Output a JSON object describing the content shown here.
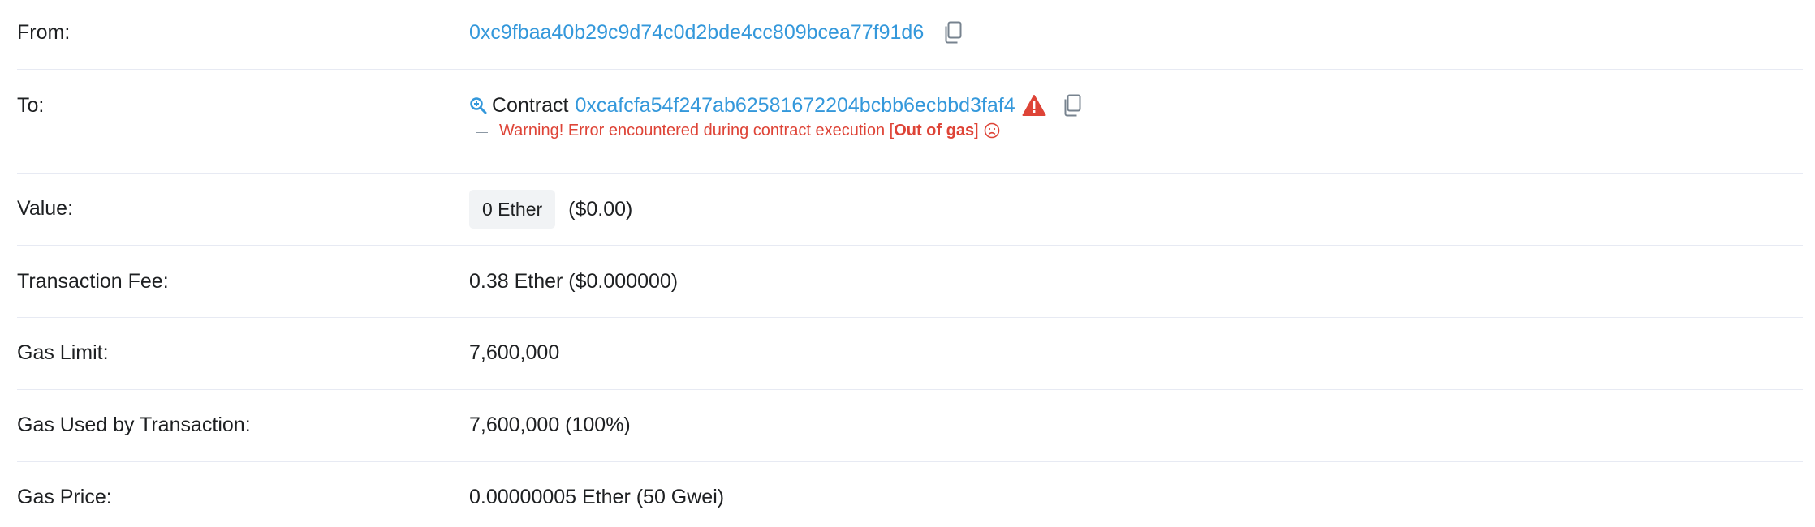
{
  "rows": {
    "from": {
      "label": "From:",
      "address": "0xc9fbaa40b29c9d74c0d2bde4cc809bcea77f91d6"
    },
    "to": {
      "label": "To:",
      "contract_word": "Contract",
      "address": "0xcafcfa54f247ab62581672204bcbb6ecbbd3faf4",
      "warning_prefix": "Warning! Error encountered during contract execution [",
      "warning_error": "Out of gas",
      "warning_suffix": "]"
    },
    "value": {
      "label": "Value:",
      "amount": "0 Ether",
      "usd": "($0.00)"
    },
    "fee": {
      "label": "Transaction Fee:",
      "value": "0.38 Ether ($0.000000)"
    },
    "gas_limit": {
      "label": "Gas Limit:",
      "value": "7,600,000"
    },
    "gas_used": {
      "label": "Gas Used by Transaction:",
      "value": "7,600,000 (100%)"
    },
    "gas_price": {
      "label": "Gas Price:",
      "value": "0.00000005 Ether (50 Gwei)"
    }
  },
  "colors": {
    "link": "#3498db",
    "warning": "#de4437",
    "divider": "#e7eaf3",
    "badge_bg": "#f1f3f5"
  },
  "icons": {
    "copy": "copy-icon",
    "search": "search-icon",
    "warning": "warning-triangle-icon",
    "sad": "sad-face-icon"
  }
}
